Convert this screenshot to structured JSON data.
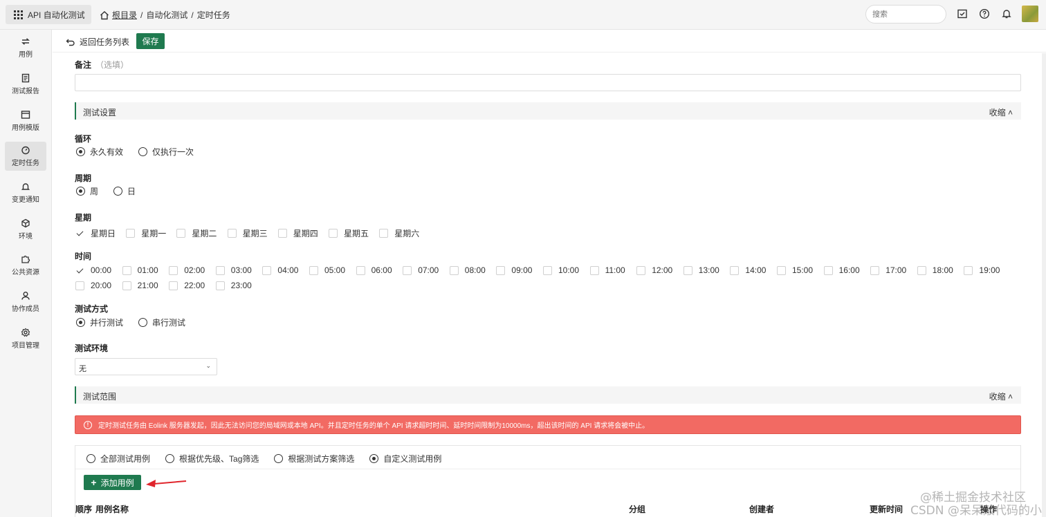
{
  "app": {
    "title": "API 自动化测试"
  },
  "breadcrumb": {
    "root": "根目录",
    "items": [
      "自动化测试",
      "定时任务"
    ],
    "sep": "/"
  },
  "search": {
    "placeholder": "搜索"
  },
  "sidebar": {
    "items": [
      {
        "label": "用例",
        "icon": "swap-icon"
      },
      {
        "label": "测试报告",
        "icon": "report-icon"
      },
      {
        "label": "用例模版",
        "icon": "template-icon"
      },
      {
        "label": "定时任务",
        "icon": "timer-icon",
        "active": true
      },
      {
        "label": "变更通知",
        "icon": "bell-icon"
      },
      {
        "label": "环境",
        "icon": "cube-icon"
      },
      {
        "label": "公共资源",
        "icon": "puzzle-icon"
      },
      {
        "label": "协作成员",
        "icon": "user-icon"
      },
      {
        "label": "项目管理",
        "icon": "gear-icon"
      }
    ]
  },
  "toolbar": {
    "back_label": "返回任务列表",
    "save_label": "保存"
  },
  "remark": {
    "label": "备注",
    "hint": "（选填）",
    "value": ""
  },
  "test_settings": {
    "title": "测试设置",
    "collapse": "收缩 ˄",
    "loop": {
      "label": "循环",
      "options": [
        "永久有效",
        "仅执行一次"
      ],
      "selected": 0
    },
    "period": {
      "label": "周期",
      "options": [
        "周",
        "日"
      ],
      "selected": 0
    },
    "weekday": {
      "label": "星期",
      "options": [
        "星期日",
        "星期一",
        "星期二",
        "星期三",
        "星期四",
        "星期五",
        "星期六"
      ],
      "checked": [
        0
      ]
    },
    "time": {
      "label": "时间",
      "options": [
        "00:00",
        "01:00",
        "02:00",
        "03:00",
        "04:00",
        "05:00",
        "06:00",
        "07:00",
        "08:00",
        "09:00",
        "10:00",
        "11:00",
        "12:00",
        "13:00",
        "14:00",
        "15:00",
        "16:00",
        "17:00",
        "18:00",
        "19:00",
        "20:00",
        "21:00",
        "22:00",
        "23:00"
      ],
      "checked": [
        0
      ]
    },
    "mode": {
      "label": "测试方式",
      "options": [
        "并行测试",
        "串行测试"
      ],
      "selected": 0
    },
    "env": {
      "label": "测试环境",
      "value": "无"
    }
  },
  "test_scope": {
    "title": "测试范围",
    "collapse": "收缩 ˄",
    "alert": "定时测试任务由 Eolink 服务器发起，因此无法访问您的局域网或本地 API。并且定时任务的单个 API 请求超时时间、延时时间限制为10000ms，超出该时间的 API 请求将会被中止。",
    "options": [
      "全部测试用例",
      "根据优先级、Tag筛选",
      "根据测试方案筛选",
      "自定义测试用例"
    ],
    "selected": 3,
    "add_label": "添加用例",
    "columns": [
      "顺序",
      "用例名称",
      "分组",
      "创建者",
      "更新时间",
      "操作"
    ]
  },
  "watermark": {
    "line1": "@稀土掘金技术社区",
    "line2": "CSDN @呆呆敲代码的小Y"
  },
  "colors": {
    "primary": "#1f7a4f",
    "alert": "#f26a63"
  }
}
